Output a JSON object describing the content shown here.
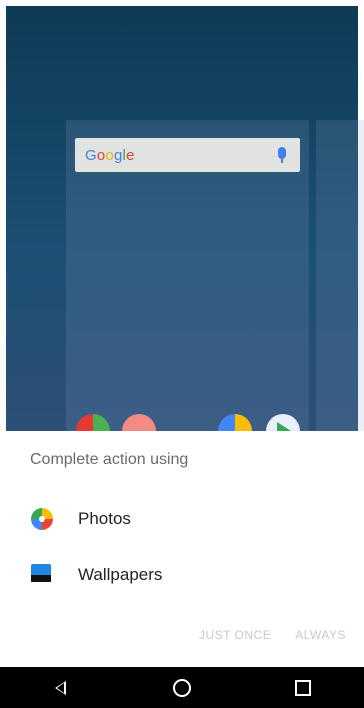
{
  "home": {
    "search_brand": [
      "G",
      "o",
      "o",
      "g",
      "l",
      "e"
    ]
  },
  "dialog": {
    "title": "Complete action using",
    "options": [
      {
        "label": "Photos",
        "icon": "google-photos-icon"
      },
      {
        "label": "Wallpapers",
        "icon": "wallpapers-icon"
      }
    ],
    "actions": {
      "just_once": "JUST ONCE",
      "always": "ALWAYS"
    }
  },
  "navbar": {
    "back_icon": "back-icon",
    "home_icon": "home-icon",
    "recents_icon": "recents-icon"
  },
  "colors": {
    "wallpaper_top": "#0d3a55",
    "wallpaper_bottom": "#3a3f66",
    "sheet_bg": "#ffffff",
    "action_disabled": "#c9c9c9"
  }
}
